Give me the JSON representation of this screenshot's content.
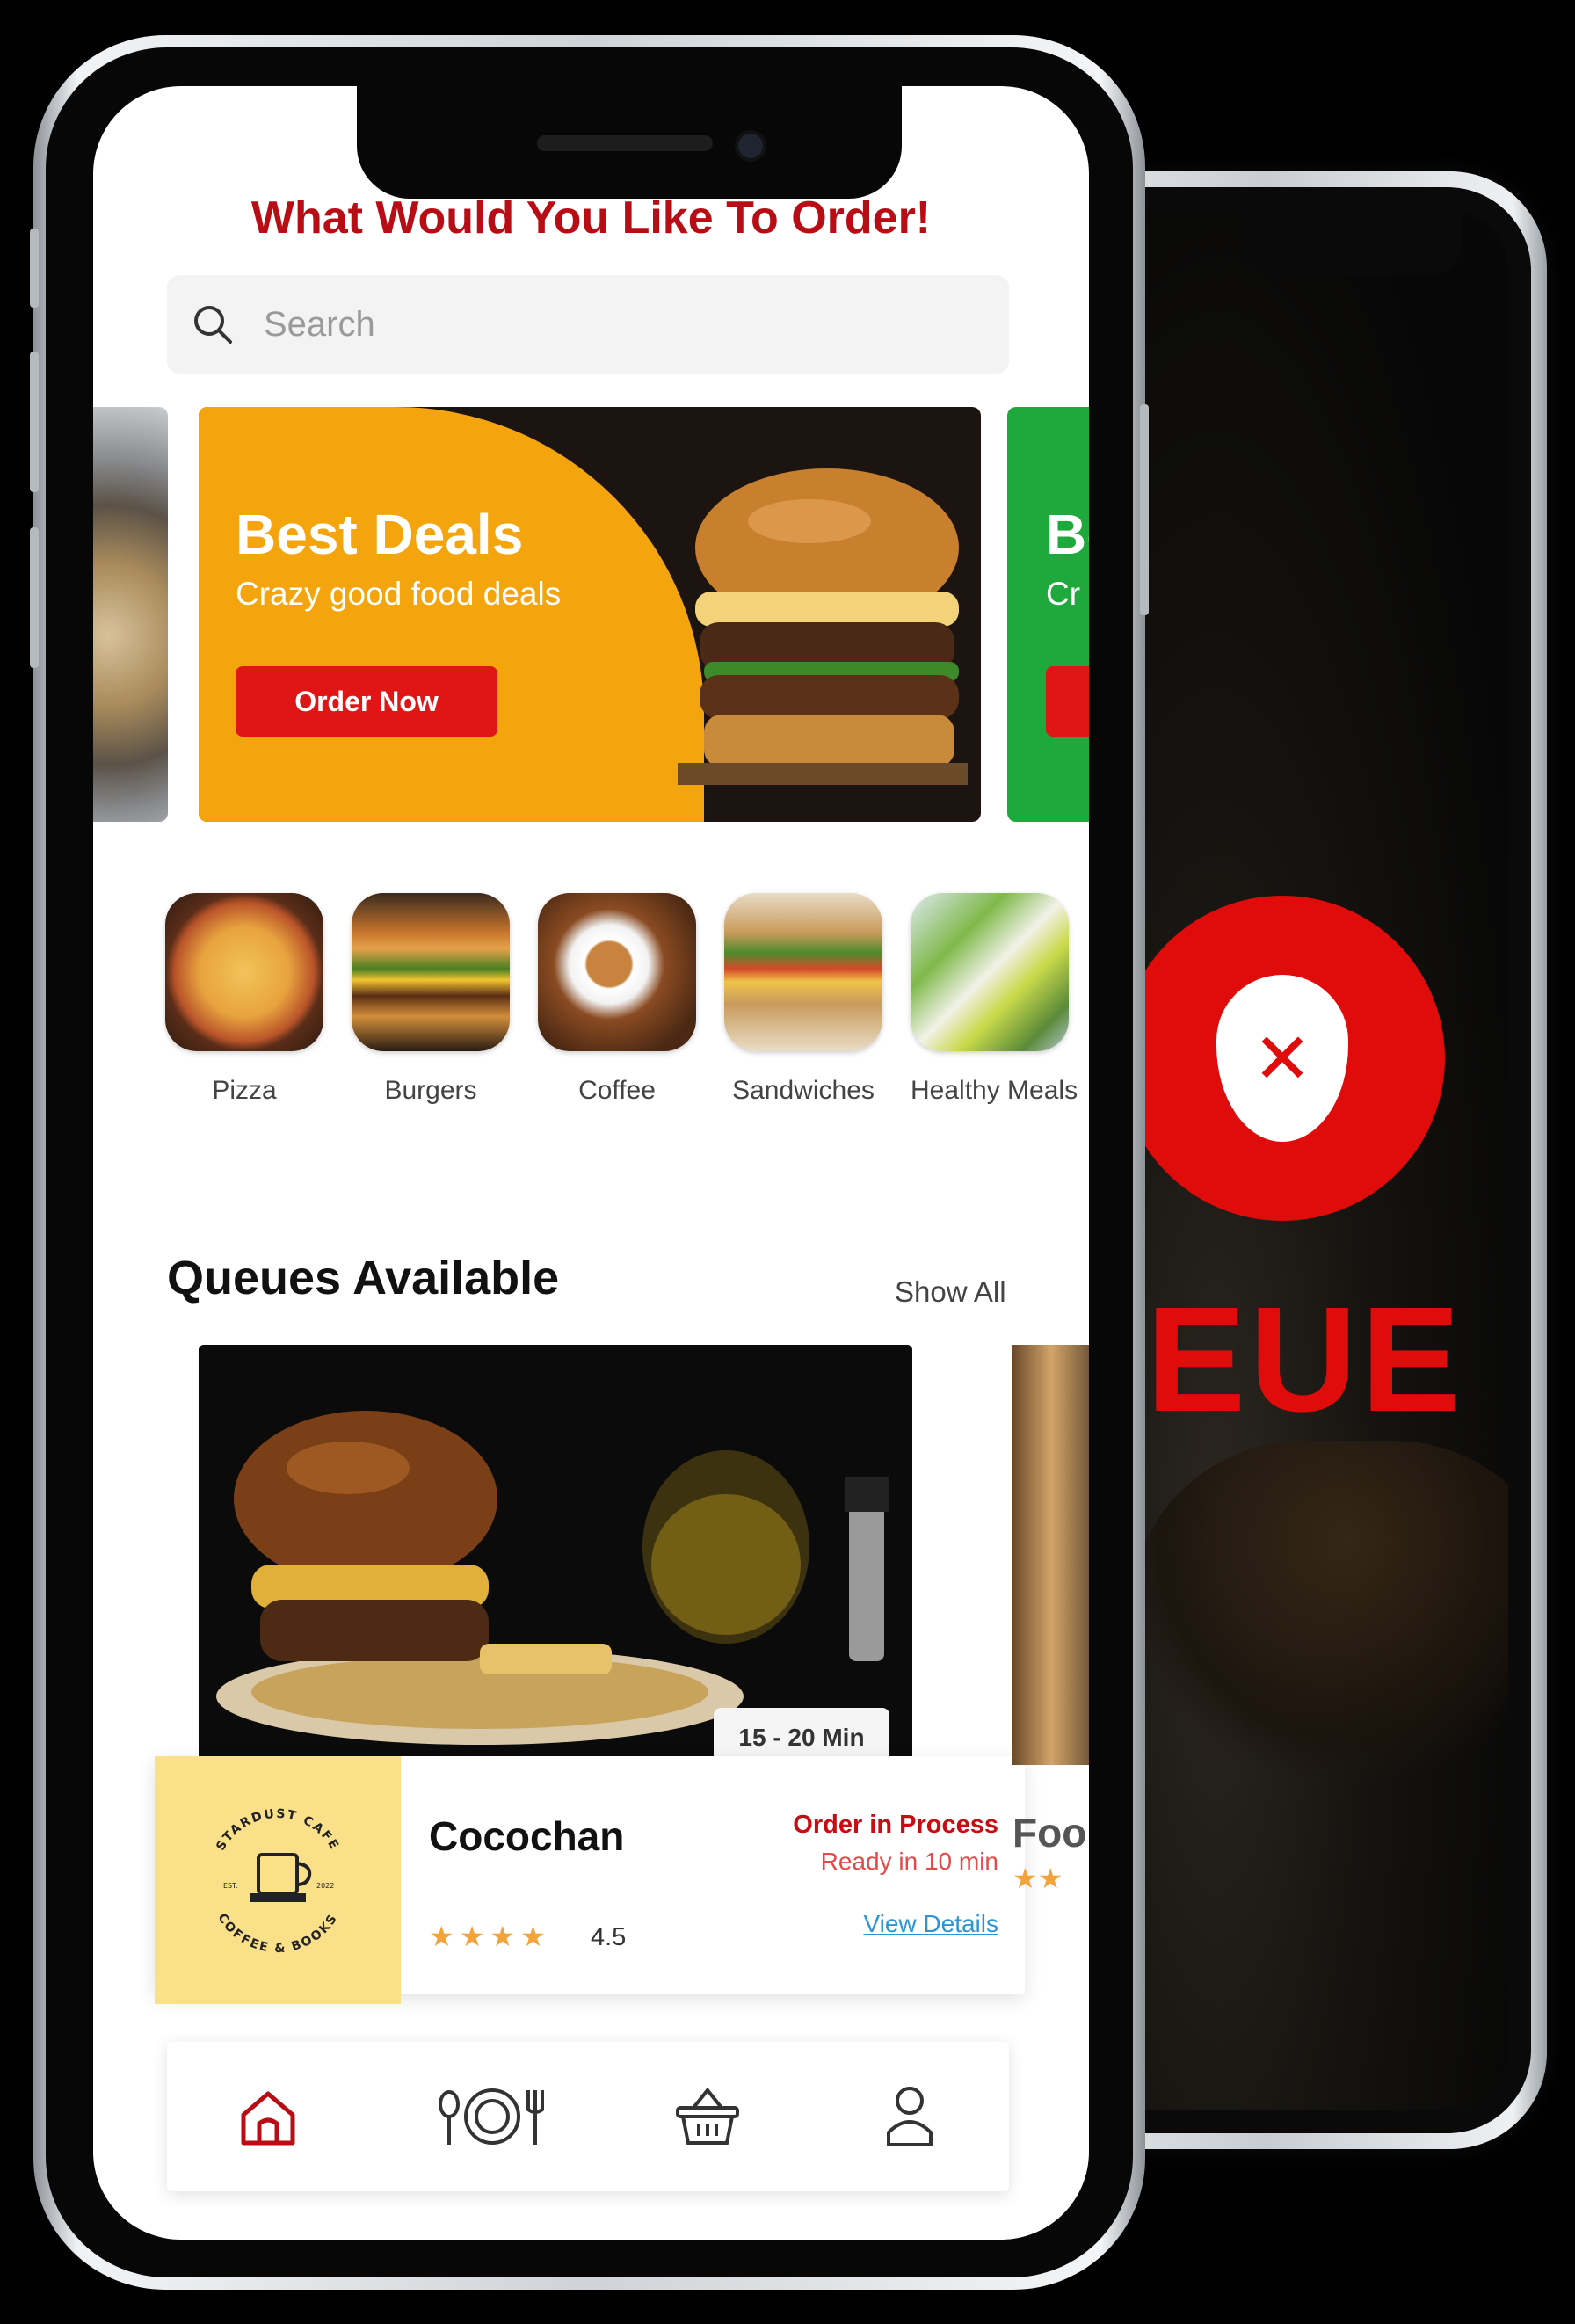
{
  "app": {
    "heading": "What Would You Like To Order!",
    "accent_color": "#b80d14",
    "brand_red": "#e01616"
  },
  "search": {
    "placeholder": "Search"
  },
  "promo_banner": {
    "headline": "Best Deals",
    "subline": "Crazy good food deals",
    "button_label": "Order Now",
    "background_color": "#f4a40c"
  },
  "promo_banner_next": {
    "headline": "Be",
    "subline": "Cr",
    "background_color": "#1fa83c"
  },
  "categories": [
    {
      "label": "Pizza"
    },
    {
      "label": "Burgers"
    },
    {
      "label": "Coffee"
    },
    {
      "label": "Sandwiches"
    },
    {
      "label": "Healthy Meals"
    }
  ],
  "queues": {
    "title": "Queues Available",
    "show_all_label": "Show All",
    "cards": [
      {
        "time_badge": "15 - 20 Min",
        "store_name": "Cocochan",
        "logo_text_top": "STARDUST CAFE",
        "logo_text_bottom": "COFFEE & BOOKS",
        "logo_est": "EST.",
        "logo_year": "2022",
        "stars": "★★★★",
        "rating": "4.5",
        "status": "Order in Process",
        "ready": "Ready in 10 min",
        "details_link": "View Details"
      }
    ],
    "peek_card": {
      "name_fragment": "Foo",
      "stars": "★★"
    }
  },
  "bottom_nav": [
    {
      "icon": "home-icon",
      "active": true
    },
    {
      "icon": "dining-icon",
      "active": false
    },
    {
      "icon": "basket-icon",
      "active": false
    },
    {
      "icon": "profile-icon",
      "active": false
    }
  ],
  "back_phone": {
    "word_fragment": "EUE"
  }
}
